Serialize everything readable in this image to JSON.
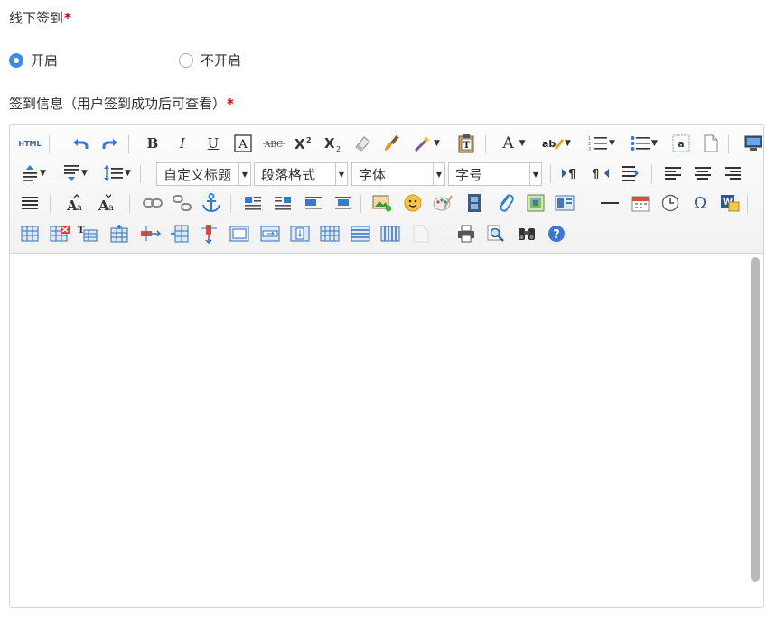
{
  "offline_signin": {
    "label": "线下签到",
    "required_mark": "*",
    "options": [
      {
        "label": "开启",
        "checked": true
      },
      {
        "label": "不开启",
        "checked": false
      }
    ]
  },
  "signin_info": {
    "label": "签到信息（用户签到成功后可查看）",
    "required_mark": "*"
  },
  "toolbar": {
    "html_label": "HTML",
    "bold": "B",
    "italic": "I",
    "underline": "U",
    "font_color": "A",
    "custom_title": "自定义标题",
    "paragraph_format": "段落格式",
    "font_family": "字体",
    "font_size": "字号",
    "omega": "Ω"
  },
  "colors": {
    "accent": "#3a8ee6",
    "required": "#d40000",
    "toolbar_bg": "#f1f1f1"
  }
}
